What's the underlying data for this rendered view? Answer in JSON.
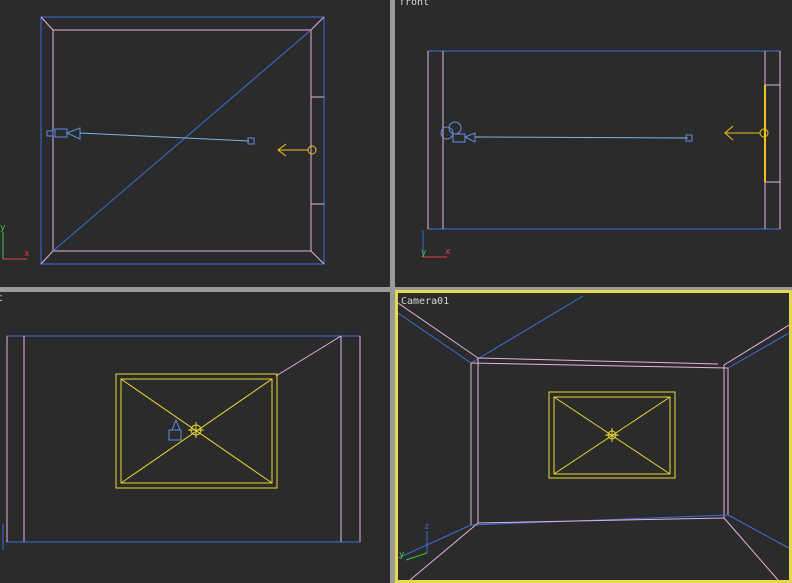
{
  "viewports": {
    "top": {
      "label": ""
    },
    "front": {
      "label": "front"
    },
    "left": {
      "label": "t"
    },
    "camera": {
      "label": "Camera01"
    }
  },
  "axes": {
    "x": "x",
    "y": "y",
    "z": "z"
  },
  "colors": {
    "background": "#2b2b2b",
    "divider": "#9a9a9a",
    "active_border": "#e6d84a",
    "room_blue": "#3a6fd8",
    "room_pink": "#e8b0e0",
    "selected_yellow": "#e8d830",
    "camera_line": "#7ab8e6",
    "light_orange": "#f0c020"
  }
}
